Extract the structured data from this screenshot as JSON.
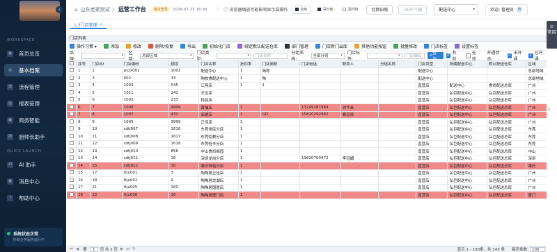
{
  "sidebar": {
    "workspace_title": "WORKSPACE",
    "items": [
      {
        "label": "首页总览",
        "icon": "home-icon",
        "glyph": "▦"
      },
      {
        "label": "基本档案",
        "icon": "archive-icon",
        "glyph": "▤"
      },
      {
        "label": "流程管理",
        "icon": "flow-icon",
        "glyph": "流"
      },
      {
        "label": "报表管理",
        "icon": "report-icon",
        "glyph": "▥"
      },
      {
        "label": "商务智能",
        "icon": "bi-icon",
        "glyph": "▩"
      },
      {
        "label": "厨师长助手",
        "icon": "chef-icon",
        "glyph": "厨"
      }
    ],
    "quick_title": "QUICK LAUNCH",
    "quick_items": [
      {
        "label": "AI 助手",
        "icon": "ai-icon",
        "glyph": "AI"
      },
      {
        "label": "消息中心",
        "icon": "message-icon",
        "glyph": "▣"
      },
      {
        "label": "帮助中心",
        "icon": "help-icon",
        "glyph": "?"
      }
    ],
    "status_title": "系统状态正常",
    "status_sub": "所有业务服务运行中"
  },
  "topbar": {
    "crumb1": "山东老家测试",
    "crumb_sep": "/",
    "title": "运营工作台",
    "last_login_label": "最近登录",
    "last_login_time": "2026-07-25 16:36",
    "warning": "浏览器缩放可能影响显示或操作",
    "chip1": "自色",
    "chip2": "深石板",
    "chip3": "清料特",
    "old_version": "切换旧版",
    "app_download": "APP下载",
    "center_select": "配送中心",
    "welcome": "欢迎: 管理员",
    "avatar": "管"
  },
  "tab": {
    "label": "1.3门店管理",
    "close": "×"
  },
  "right_panel": {
    "label": "常用",
    "arrow": "‹"
  },
  "panel_title": "门店列表",
  "toolbar": [
    {
      "label": "操作习惯 ▾",
      "cls": "b"
    },
    {
      "label": "添加",
      "cls": "g"
    },
    {
      "label": "修改",
      "cls": "o"
    },
    {
      "label": "删除/恢复",
      "cls": "r"
    },
    {
      "label": "导出",
      "cls": "b"
    },
    {
      "label": "初始化门店",
      "cls": "g"
    },
    {
      "label": "绑定默认配送仓库",
      "cls": "p"
    },
    {
      "label": "部门管理",
      "cls": "k"
    },
    {
      "label": "门店新门出库",
      "cls": "b"
    },
    {
      "label": "其他功能按钮",
      "cls": "o"
    },
    {
      "label": "批量修改",
      "cls": "g"
    },
    {
      "label": "门店标签",
      "cls": "b"
    },
    {
      "label": "设置标签",
      "cls": "p"
    }
  ],
  "filters": {
    "brand_label": "品牌:",
    "region_label": "区域:",
    "region_value": "总部区域",
    "type_label": "门店类型:",
    "name_placeholder": "门店名称",
    "group_label": "分组名称:",
    "group_value": "全部分组",
    "tag_label": "门店标签:",
    "code_placeholder": "门店编码",
    "query": "查询",
    "valid": "有效",
    "invalid": "无效",
    "open_status_label": "开通状态:",
    "not_open": "未开通",
    "opened": "已开通"
  },
  "table": {
    "headers": [
      "",
      "序号",
      "门店ID",
      "门店编码",
      "顺序",
      "门店名称",
      "折扣率",
      "门店简称",
      "门店电话",
      "联系人",
      "分组名称",
      "门店类型",
      "所属配送中心",
      "默认配送仓库",
      "区域",
      "品牌"
    ],
    "rows": [
      {
        "hl": false,
        "cells": [
          "1",
          "1",
          "pszx002",
          "1002",
          "配送中心",
          "1",
          "简称",
          "",
          "",
          "",
          "配送中心",
          "",
          "",
          "总部地域",
          ""
        ]
      },
      {
        "hl": false,
        "cells": [
          "2",
          "3",
          "002",
          "33",
          "陶牧食配送中心",
          "1",
          "陶",
          "",
          "",
          "",
          "配送中心",
          "",
          "",
          "总部地域",
          ""
        ]
      },
      {
        "hl": false,
        "cells": [
          "3",
          "4",
          "1003",
          "545",
          "江燕店",
          "1",
          "1",
          "",
          "",
          "",
          "直营店",
          "配送中心",
          "食尚配送总库",
          "广州",
          "山东老"
        ]
      },
      {
        "hl": false,
        "cells": [
          "4",
          "5",
          "1011",
          "242",
          "天龙店",
          "",
          "",
          "",
          "",
          "",
          "直营店",
          "弘巨配送中心",
          "弘巨配送总库",
          "广州",
          "山东老"
        ]
      },
      {
        "hl": false,
        "cells": [
          "5",
          "6",
          "1002",
          "233",
          "科韵店",
          "",
          "",
          "",
          "",
          "",
          "直营店",
          "弘巨配送中心",
          "弘巨配送总库",
          "广州",
          "山东老"
        ]
      },
      {
        "hl": true,
        "cells": [
          "6",
          "7",
          "1008",
          "9999",
          "黄埔店",
          "1",
          "",
          "13249181984",
          "钟华贵",
          "",
          "直营店",
          "弘巨配送中心",
          "弘巨配送总库",
          "广州",
          "山东老"
        ]
      },
      {
        "hl": true,
        "cells": [
          "7",
          "8",
          "1007",
          "432",
          "高塘店",
          "1",
          "GD",
          "15820292982",
          "蔡忠良",
          "",
          "直营店",
          "弘巨配送中心",
          "弘巨配送总库",
          "广州",
          "山东老"
        ]
      },
      {
        "hl": false,
        "cells": [
          "8",
          "9",
          "1005",
          "9999",
          "正佳店",
          "1",
          "",
          "",
          "",
          "",
          "直营店",
          "弘巨配送中心",
          "弘巨配送总库",
          "广州",
          "山东老"
        ]
      },
      {
        "hl": false,
        "cells": [
          "9",
          "10",
          "sdtj007",
          "1616",
          "东莞常民分店",
          "1",
          "",
          "",
          "",
          "",
          "直营店",
          "弘巨配送中心",
          "弘巨配送总库",
          "东莞",
          "山东老"
        ]
      },
      {
        "hl": false,
        "cells": [
          "10",
          "11",
          "sdtj008",
          "1617",
          "东莞惊赛分店",
          "1",
          "",
          "",
          "",
          "",
          "直营店",
          "弘巨配送中心",
          "弘巨配送总库",
          "东莞",
          "山东老"
        ]
      },
      {
        "hl": false,
        "cells": [
          "11",
          "12",
          "sdtj009",
          "1618",
          "东莞怡丰分店",
          "1",
          "",
          "",
          "",
          "",
          "直营店",
          "弘巨配送中心",
          "弘巨配送总库",
          "东莞",
          "山东老"
        ]
      },
      {
        "hl": false,
        "cells": [
          "12",
          "13",
          "sdtj010",
          "856",
          "中山食尚继园",
          "1",
          "",
          "",
          "",
          "",
          "直营店",
          "弘巨配送中心",
          "弘巨配送总库",
          "中山",
          "山东老"
        ]
      },
      {
        "hl": false,
        "cells": [
          "13",
          "14",
          "sdtj011",
          "16",
          "深圳龙岗分店",
          "1",
          "",
          "19820760472",
          "李钰媚",
          "",
          "直营店",
          "弘巨配送中心",
          "弘巨配送总库",
          "深圳",
          "山东老"
        ]
      },
      {
        "hl": true,
        "cells": [
          "14",
          "15",
          "sdtj012",
          "16",
          "肇庆恒裕分店",
          "1",
          "",
          "",
          "",
          "",
          "直营店",
          "弘巨配送中心",
          "弘巨配送总库",
          "肇庆",
          "山东老"
        ]
      },
      {
        "hl": false,
        "cells": [
          "15",
          "17",
          "ttju001",
          "3",
          "陶陶居正佳店",
          "1",
          "",
          "",
          "",
          "",
          "直营店",
          "弘巨配送中心",
          "弘巨配送总库",
          "广州",
          "山东老"
        ]
      },
      {
        "hl": false,
        "cells": [
          "16",
          "18",
          "ttju002",
          "9",
          "陶陶居龙湖店",
          "1",
          "",
          "",
          "",
          "",
          "直营店",
          "弘巨配送中心",
          "弘巨配送总库",
          "广州",
          "山东老"
        ]
      },
      {
        "hl": false,
        "cells": [
          "17",
          "21",
          "ttju005",
          "160",
          "陶陶居国盈店",
          "1",
          "",
          "",
          "",
          "",
          "直营店",
          "弘巨配送中心",
          "弘巨配送总库",
          "广州",
          "山东老"
        ]
      },
      {
        "hl": true,
        "cells": [
          "18",
          "22",
          "ttju006",
          "16",
          "陶陶居厦门店",
          "1",
          "",
          "",
          "",
          "",
          "直营店",
          "弘巨配送中心",
          "弘巨配送总库",
          "厦门",
          "山东老"
        ]
      }
    ]
  },
  "pager": {
    "first": "⏮",
    "prev": "◀",
    "page_label": "第",
    "page": "1",
    "of": "页 共 2 页",
    "next": "▶",
    "last": "⏭",
    "refresh": "↻",
    "info": "显示 1 - 100条，共 143 条",
    "size_label": "每页条数:",
    "size": "100"
  }
}
